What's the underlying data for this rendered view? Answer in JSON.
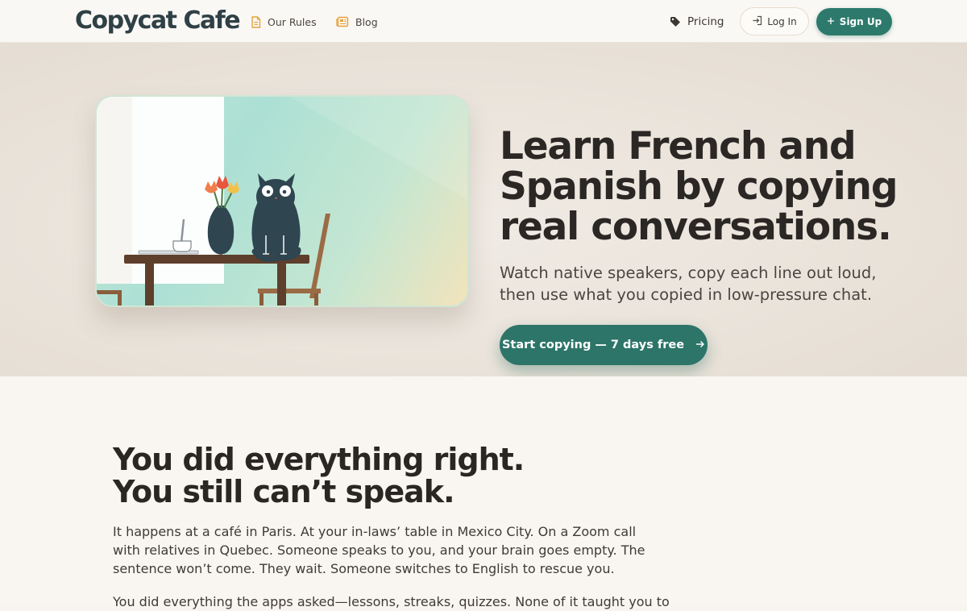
{
  "header": {
    "logo": "Copycat Cafe",
    "nav": [
      {
        "label": "Our Rules",
        "icon": "document-icon"
      },
      {
        "label": "Blog",
        "icon": "newspaper-icon"
      }
    ],
    "pricing_label": "Pricing",
    "login_label": "Log In",
    "signup_label": "Sign Up"
  },
  "hero": {
    "title_lines": [
      "Learn French and",
      "Spanish by copying",
      "real conversations."
    ],
    "subtitle_lines": [
      "Watch native speakers, copy each line out loud,",
      "then use what you copied in low-pressure chat."
    ],
    "cta_label": "Start copying — 7 days free",
    "illustration": "cat-at-cafe-table-illustration"
  },
  "section": {
    "title_lines": [
      "You did everything right.",
      "You still can’t speak."
    ],
    "para1_lines": [
      "It happens at a café in Paris. At your in-laws’ table in Mexico City. On a Zoom call",
      "with relatives in Quebec. Someone speaks to you, and your brain goes empty. The",
      "sentence won’t come. They wait. Someone switches to English to rescue you."
    ],
    "para2_lines": [
      "You did everything the apps asked—lessons, streaks, quizzes. None of it taught you to"
    ]
  },
  "colors": {
    "brand_teal": "#2d7a6c",
    "logo_slate": "#2f4046",
    "icon_orange": "#e5a23a"
  }
}
